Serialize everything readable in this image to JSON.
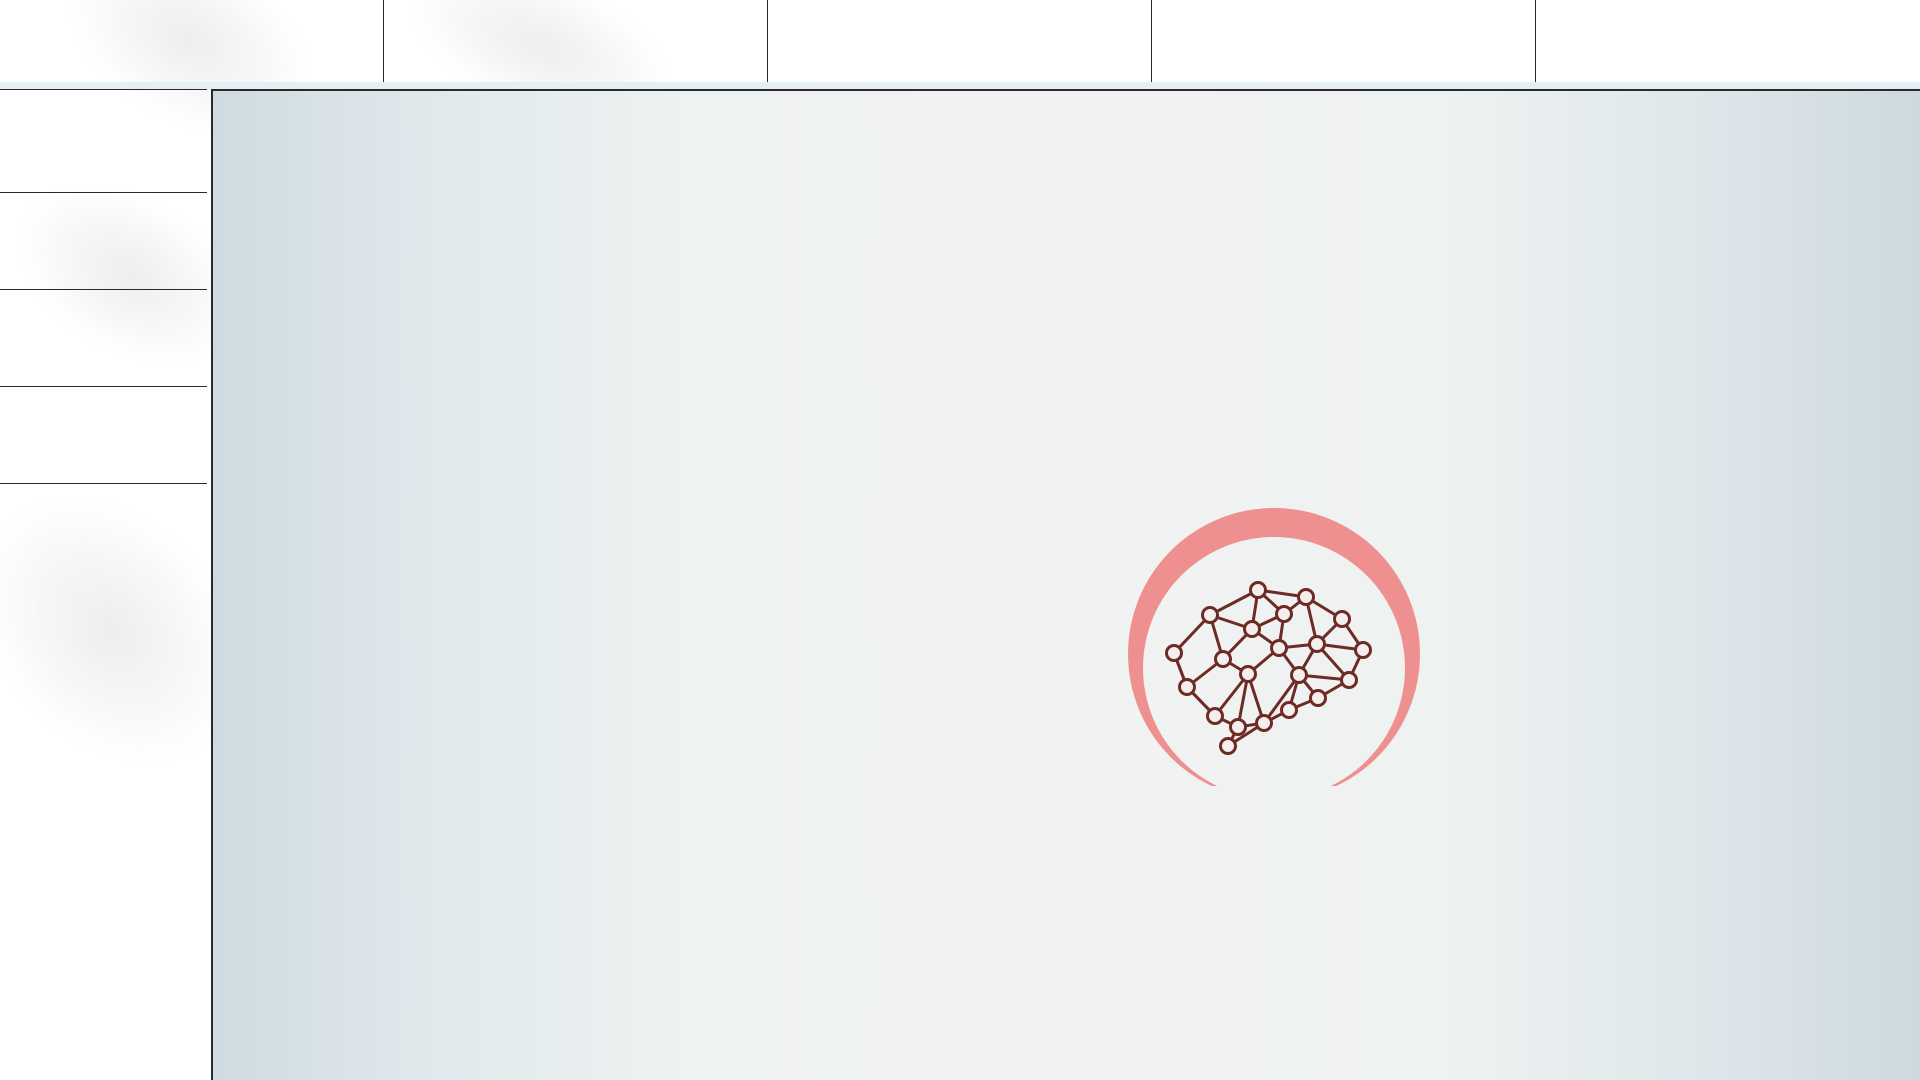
{
  "app": {
    "accent_color": "#ee9090",
    "icon_color": "#6e2a24"
  },
  "top_tabs": [
    "",
    "",
    "",
    "",
    ""
  ],
  "side_items": [
    "",
    "",
    "",
    ""
  ],
  "loader": {
    "icon": "brain-network-icon",
    "spinner": "loading-ring"
  }
}
